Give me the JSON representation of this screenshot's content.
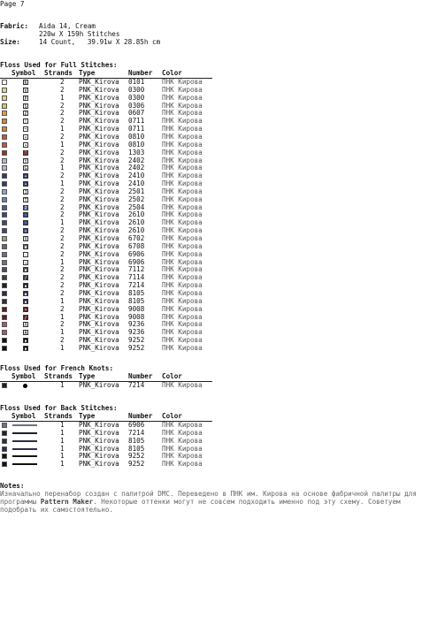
{
  "page_label": "Page 7",
  "fabric": {
    "label": "Fabric:",
    "line1": "Aida 14, Cream",
    "line2": "220w X 159h Stitches"
  },
  "size": {
    "label": "Size:",
    "value": "14 Count,   39.91w X 28.85h cm"
  },
  "full_stitches": {
    "title": "Floss Used for Full Stitches:",
    "headers": {
      "symbol": "Symbol",
      "strands": "Strands",
      "type": "Type",
      "number": "Number",
      "color": "Color"
    },
    "rows": [
      {
        "color": "#ffffff",
        "symbol": "K",
        "strands": "2",
        "type": "PNK_Kirova",
        "number": "0101",
        "name": "ПНК Кирова"
      },
      {
        "color": "#e6d28a",
        "symbol": "V",
        "strands": "2",
        "type": "PNK_Kirova",
        "number": "0300",
        "name": "ПНК Кирова"
      },
      {
        "color": "#e6d28a",
        "symbol": "P",
        "strands": "1",
        "type": "PNK_Kirova",
        "number": "0300",
        "name": "ПНК Кирова"
      },
      {
        "color": "#e0c060",
        "symbol": "S",
        "strands": "2",
        "type": "PNK_Kirova",
        "number": "0306",
        "name": "ПНК Кирова"
      },
      {
        "color": "#e39b3c",
        "symbol": "Ƨ",
        "strands": "2",
        "type": "PNK_Kirova",
        "number": "0607",
        "name": "ПНК Кирова"
      },
      {
        "color": "#d6882e",
        "symbol": "!",
        "strands": "2",
        "type": "PNK_Kirova",
        "number": "0711",
        "name": "ПНК Кирова"
      },
      {
        "color": "#d6882e",
        "symbol": "¬",
        "strands": "1",
        "type": "PNK_Kirova",
        "number": "0711",
        "name": "ПНК Кирова"
      },
      {
        "color": "#c05a3e",
        "symbol": "•",
        "strands": "2",
        "type": "PNK_Kirova",
        "number": "0810",
        "name": "ПНК Кирова"
      },
      {
        "color": "#c05a3e",
        "symbol": "•",
        "strands": "1",
        "type": "PNK_Kirova",
        "number": "0810",
        "name": "ПНК Кирова"
      },
      {
        "color": "#8a3a30",
        "symbol": "ˇ",
        "strands": "2",
        "type": "PNK_Kirova",
        "number": "1303",
        "name": "ПНК Кирова"
      },
      {
        "color": "#b7b7c7",
        "symbol": "Y",
        "strands": "2",
        "type": "PNK_Kirova",
        "number": "2402",
        "name": "ПНК Кирова"
      },
      {
        "color": "#b7b7c7",
        "symbol": "G",
        "strands": "1",
        "type": "PNK_Kirova",
        "number": "2402",
        "name": "ПНК Кирова"
      },
      {
        "color": "#2e3c72",
        "symbol": "•",
        "strands": "2",
        "type": "PNK_Kirova",
        "number": "2410",
        "name": "ПНК Кирова"
      },
      {
        "color": "#2e3c72",
        "symbol": "•",
        "strands": "1",
        "type": "PNK_Kirova",
        "number": "2410",
        "name": "ПНК Кирова"
      },
      {
        "color": "#8fa6c8",
        "symbol": "J",
        "strands": "2",
        "type": "PNK_Kirova",
        "number": "2501",
        "name": "ПНК Кирова"
      },
      {
        "color": "#6c84ad",
        "symbol": "T",
        "strands": "2",
        "type": "PNK_Kirova",
        "number": "2502",
        "name": "ПНК Кирова"
      },
      {
        "color": "#4a5f8f",
        "symbol": "Z",
        "strands": "2",
        "type": "PNK_Kirova",
        "number": "2504",
        "name": "ПНК Кирова"
      },
      {
        "color": "#3a4a80",
        "symbol": "◦",
        "strands": "2",
        "type": "PNK_Kirova",
        "number": "2610",
        "name": "ПНК Кирова"
      },
      {
        "color": "#3a4a80",
        "symbol": "◦",
        "strands": "1",
        "type": "PNK_Kirova",
        "number": "2610",
        "name": "ПНК Кирова"
      },
      {
        "color": "#3a4a80",
        "symbol": "•",
        "strands": "2",
        "type": "PNK_Kirova",
        "number": "2610",
        "name": "ПНК Кирова"
      },
      {
        "color": "#9a9a8a",
        "symbol": "X",
        "strands": "2",
        "type": "PNK_Kirova",
        "number": "6702",
        "name": "ПНК Кирова"
      },
      {
        "color": "#6a6a5c",
        "symbol": "▪",
        "strands": "2",
        "type": "PNK_Kirova",
        "number": "6708",
        "name": "ПНК Кирова"
      },
      {
        "color": "#6a7286",
        "symbol": "◦",
        "strands": "2",
        "type": "PNK_Kirova",
        "number": "6906",
        "name": "ПНК Кирова"
      },
      {
        "color": "#6a7286",
        "symbol": "→",
        "strands": "1",
        "type": "PNK_Kirova",
        "number": "6906",
        "name": "ПНК Кирова"
      },
      {
        "color": "#4d4f5e",
        "symbol": "▪",
        "strands": "2",
        "type": "PNK_Kirova",
        "number": "7112",
        "name": "ПНК Кирова"
      },
      {
        "color": "#3a3c4a",
        "symbol": "/",
        "strands": "2",
        "type": "PNK_Kirova",
        "number": "7114",
        "name": "ПНК Кирова"
      },
      {
        "color": "#1f2028",
        "symbol": "▪",
        "strands": "2",
        "type": "PNK_Kirova",
        "number": "7214",
        "name": "ПНК Кирова"
      },
      {
        "color": "#2b2f48",
        "symbol": "◆",
        "strands": "2",
        "type": "PNK_Kirova",
        "number": "8105",
        "name": "ПНК Кирова"
      },
      {
        "color": "#2b2f48",
        "symbol": "▪",
        "strands": "1",
        "type": "PNK_Kirova",
        "number": "8105",
        "name": "ПНК Кирова"
      },
      {
        "color": "#5a1f22",
        "symbol": "•",
        "strands": "2",
        "type": "PNK_Kirova",
        "number": "9008",
        "name": "ПНК Кирова"
      },
      {
        "color": "#5a1f22",
        "symbol": "/",
        "strands": "1",
        "type": "PNK_Kirova",
        "number": "9008",
        "name": "ПНК Кирова"
      },
      {
        "color": "#a8546e",
        "symbol": "Λ",
        "strands": "2",
        "type": "PNK_Kirova",
        "number": "9236",
        "name": "ПНК Кирова"
      },
      {
        "color": "#a8546e",
        "symbol": "A",
        "strands": "1",
        "type": "PNK_Kirova",
        "number": "9236",
        "name": "ПНК Кирова"
      },
      {
        "color": "#121212",
        "symbol": "▪",
        "strands": "2",
        "type": "PNK_Kirova",
        "number": "9252",
        "name": "ПНК Кирова"
      },
      {
        "color": "#121212",
        "symbol": "▪",
        "strands": "1",
        "type": "PNK_Kirova",
        "number": "9252",
        "name": "ПНК Кирова"
      }
    ]
  },
  "french_knots": {
    "title": "Floss Used for French Knots:",
    "headers": {
      "symbol": "Symbol",
      "strands": "Strands",
      "type": "Type",
      "number": "Number",
      "color": "Color"
    },
    "rows": [
      {
        "color": "#1f2028",
        "strands": "1",
        "type": "PNK_Kirova",
        "number": "7214",
        "name": "ПНК Кирова"
      }
    ]
  },
  "back_stitches": {
    "title": "Floss Used for Back Stitches:",
    "headers": {
      "symbol": "Symbol",
      "strands": "Strands",
      "type": "Type",
      "number": "Number",
      "color": "Color"
    },
    "rows": [
      {
        "color": "#6a7286",
        "strands": "1",
        "type": "PNK_Kirova",
        "number": "6906",
        "name": "ПНК Кирова"
      },
      {
        "color": "#1f2028",
        "strands": "1",
        "type": "PNK_Kirova",
        "number": "7214",
        "name": "ПНК Кирова"
      },
      {
        "color": "#2b2f48",
        "strands": "1",
        "type": "PNK_Kirova",
        "number": "8105",
        "name": "ПНК Кирова"
      },
      {
        "color": "#2b2f48",
        "strands": "1",
        "type": "PNK_Kirova",
        "number": "8105",
        "name": "ПНК Кирова"
      },
      {
        "color": "#121212",
        "strands": "1",
        "type": "PNK_Kirova",
        "number": "9252",
        "name": "ПНК Кирова"
      },
      {
        "color": "#121212",
        "strands": "1",
        "type": "PNK_Kirova",
        "number": "9252",
        "name": "ПНК Кирова"
      }
    ]
  },
  "notes": {
    "title": "Notes:",
    "text_before": "Изначально перенабор создан с палитрой DMC. Переведено в ПНК им. Кирова на основе фабричной палитры для программы ",
    "pattern_maker": "Pattern Maker",
    "text_after": ". Некоторые оттенки могут не совсем подходить именно под эту схему. Советуем подобрать их самостоятельно."
  }
}
